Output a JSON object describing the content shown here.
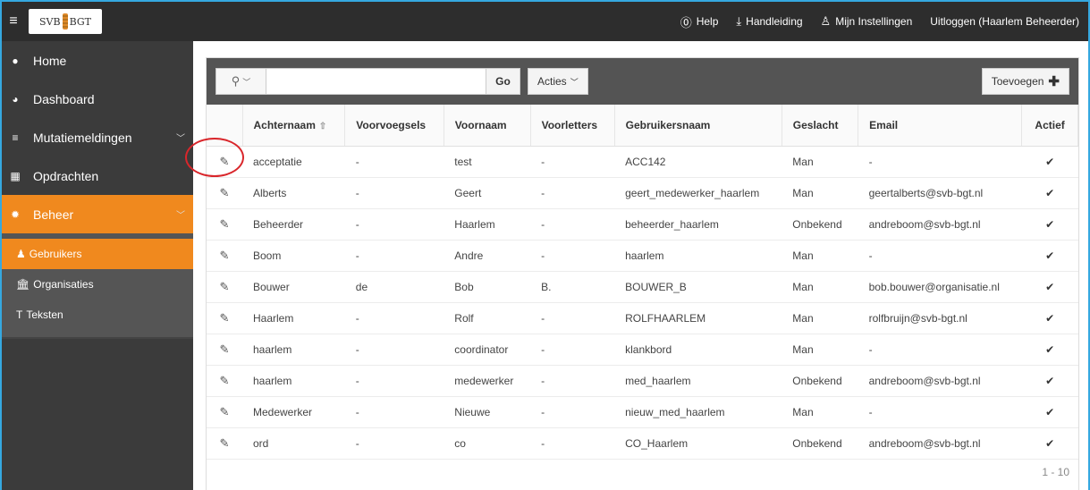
{
  "header": {
    "logo_left": "SVB",
    "logo_right": "BGT",
    "nav": [
      {
        "icon": "help-icon",
        "label": "Help"
      },
      {
        "icon": "download-icon",
        "label": "Handleiding"
      },
      {
        "icon": "user-icon",
        "label": "Mijn Instellingen"
      },
      {
        "icon": "",
        "label": "Uitloggen (Haarlem Beheerder)"
      }
    ]
  },
  "sidebar": {
    "items": [
      {
        "icon": "globe-icon",
        "label": "Home"
      },
      {
        "icon": "dashboard-icon",
        "label": "Dashboard"
      },
      {
        "icon": "list-icon",
        "label": "Mutatiemeldingen"
      },
      {
        "icon": "grid-icon",
        "label": "Opdrachten"
      },
      {
        "icon": "gear-icon",
        "label": "Beheer"
      }
    ],
    "subitems": [
      {
        "icon": "user-icon",
        "label": "Gebruikers"
      },
      {
        "icon": "bank-icon",
        "label": "Organisaties"
      },
      {
        "icon": "text-icon",
        "label": "Teksten"
      }
    ]
  },
  "toolbar": {
    "search_placeholder": "",
    "go_label": "Go",
    "acties_label": "Acties",
    "add_label": "Toevoegen"
  },
  "table": {
    "columns": [
      "",
      "Achternaam",
      "Voorvoegsels",
      "Voornaam",
      "Voorletters",
      "Gebruikersnaam",
      "Geslacht",
      "Email",
      "Actief"
    ],
    "rows": [
      [
        "acceptatie",
        "-",
        "test",
        "-",
        "ACC142",
        "Man",
        "-",
        "✔"
      ],
      [
        "Alberts",
        "-",
        "Geert",
        "-",
        "geert_medewerker_haarlem",
        "Man",
        "geertalberts@svb-bgt.nl",
        "✔"
      ],
      [
        "Beheerder",
        "-",
        "Haarlem",
        "-",
        "beheerder_haarlem",
        "Onbekend",
        "andreboom@svb-bgt.nl",
        "✔"
      ],
      [
        "Boom",
        "-",
        "Andre",
        "-",
        "haarlem",
        "Man",
        "-",
        "✔"
      ],
      [
        "Bouwer",
        "de",
        "Bob",
        "B.",
        "BOUWER_B",
        "Man",
        "bob.bouwer@organisatie.nl",
        "✔"
      ],
      [
        "Haarlem",
        "-",
        "Rolf",
        "-",
        "ROLFHAARLEM",
        "Man",
        "rolfbruijn@svb-bgt.nl",
        "✔"
      ],
      [
        "haarlem",
        "-",
        "coordinator",
        "-",
        "klankbord",
        "Man",
        "-",
        "✔"
      ],
      [
        "haarlem",
        "-",
        "medewerker",
        "-",
        "med_haarlem",
        "Onbekend",
        "andreboom@svb-bgt.nl",
        "✔"
      ],
      [
        "Medewerker",
        "-",
        "Nieuwe",
        "-",
        "nieuw_med_haarlem",
        "Man",
        "-",
        "✔"
      ],
      [
        "ord",
        "-",
        "co",
        "-",
        "CO_Haarlem",
        "Onbekend",
        "andreboom@svb-bgt.nl",
        "✔"
      ]
    ]
  },
  "pagination": {
    "range": "1 - 10"
  },
  "colors": {
    "accent": "#f0891e",
    "topbar": "#2d2d2d",
    "sidebar": "#3b3b3b",
    "highlight": "#d9262b"
  }
}
